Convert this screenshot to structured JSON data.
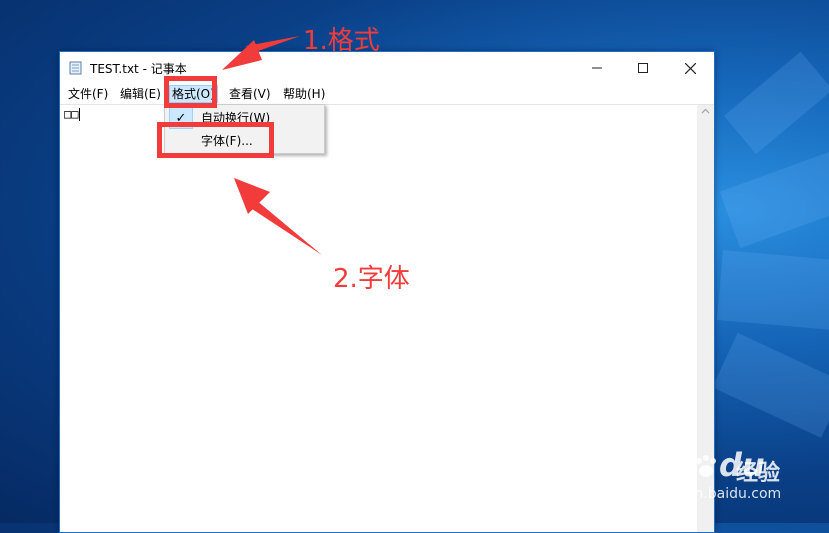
{
  "window": {
    "title": "TEST.txt - 记事本",
    "controls": {
      "minimize": "—",
      "maximize": "☐",
      "close": "✕"
    }
  },
  "menubar": {
    "items": [
      {
        "label": "文件(F)"
      },
      {
        "label": "编辑(E)"
      },
      {
        "label": "格式(O)"
      },
      {
        "label": "查看(V)"
      },
      {
        "label": "帮助(H)"
      }
    ]
  },
  "format_menu": {
    "items": [
      {
        "label": "自动换行(W)",
        "checked": true
      },
      {
        "label": "字体(F)..."
      }
    ]
  },
  "editor": {
    "content": "□□"
  },
  "annotations": {
    "step1": "1.格式",
    "step2": "2.字体",
    "color": "#f23b3b"
  },
  "watermark": {
    "brand": "Bai",
    "brand_suffix": "du",
    "product": "经验",
    "url": "jingyan.baidu.com"
  },
  "colors": {
    "desktop": "#0a3f86",
    "highlight": "#cce8ff",
    "window_border": "#1f6fc9"
  }
}
